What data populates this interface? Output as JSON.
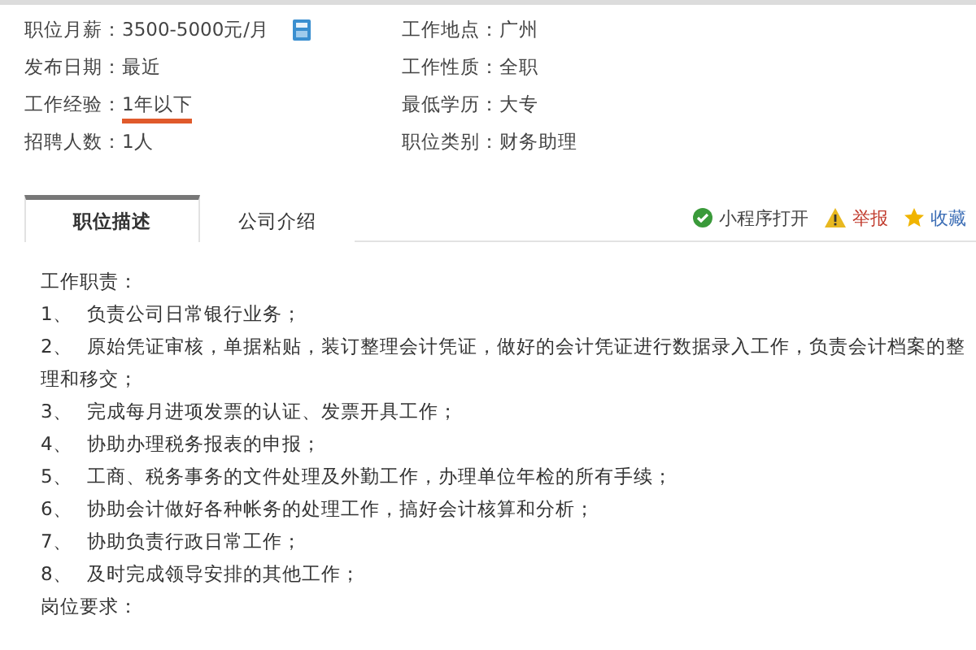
{
  "info": {
    "rows": [
      {
        "left": {
          "label": "职位月薪：",
          "value": "3500-5000元/月",
          "underlined": false,
          "calculator": true
        },
        "right": {
          "label": "工作地点：",
          "value": "广州",
          "underlined": false,
          "calculator": false
        }
      },
      {
        "left": {
          "label": "发布日期：",
          "value": "最近",
          "underlined": false,
          "calculator": false
        },
        "right": {
          "label": "工作性质：",
          "value": "全职",
          "underlined": false,
          "calculator": false
        }
      },
      {
        "left": {
          "label": "工作经验：",
          "value": "1年以下",
          "underlined": true,
          "calculator": false
        },
        "right": {
          "label": "最低学历：",
          "value": "大专",
          "underlined": false,
          "calculator": false
        }
      },
      {
        "left": {
          "label": "招聘人数：",
          "value": "1人",
          "underlined": false,
          "calculator": false
        },
        "right": {
          "label": "职位类别：",
          "value": "财务助理",
          "underlined": false,
          "calculator": false
        }
      }
    ]
  },
  "tabs": [
    {
      "label": "职位描述",
      "selected": true
    },
    {
      "label": "公司介绍",
      "selected": false
    }
  ],
  "actions": [
    {
      "kind": "open",
      "label": "小程序打开"
    },
    {
      "kind": "report",
      "label": "举报"
    },
    {
      "kind": "favorite",
      "label": "收藏"
    }
  ],
  "description": [
    {
      "heading": "工作职责：",
      "items": [
        {
          "number": "1、",
          "text": "负责公司日常银行业务；"
        },
        {
          "number": "2、",
          "text": "原始凭证审核，单据粘贴，装订整理会计凭证，做好的会计凭证进行数据录入工作，负责会计档案的整理和移交；"
        },
        {
          "number": "3、",
          "text": "完成每月进项发票的认证、发票开具工作；"
        },
        {
          "number": "4、",
          "text": "协助办理税务报表的申报；"
        },
        {
          "number": "5、",
          "text": "工商、税务事务的文件处理及外勤工作，办理单位年检的所有手续；"
        },
        {
          "number": "6、",
          "text": "协助会计做好各种帐务的处理工作，搞好会计核算和分析；"
        },
        {
          "number": "7、",
          "text": "协助负责行政日常工作；"
        },
        {
          "number": "8、",
          "text": "及时完成领导安排的其他工作；"
        }
      ]
    },
    {
      "heading": "岗位要求："
    }
  ]
}
